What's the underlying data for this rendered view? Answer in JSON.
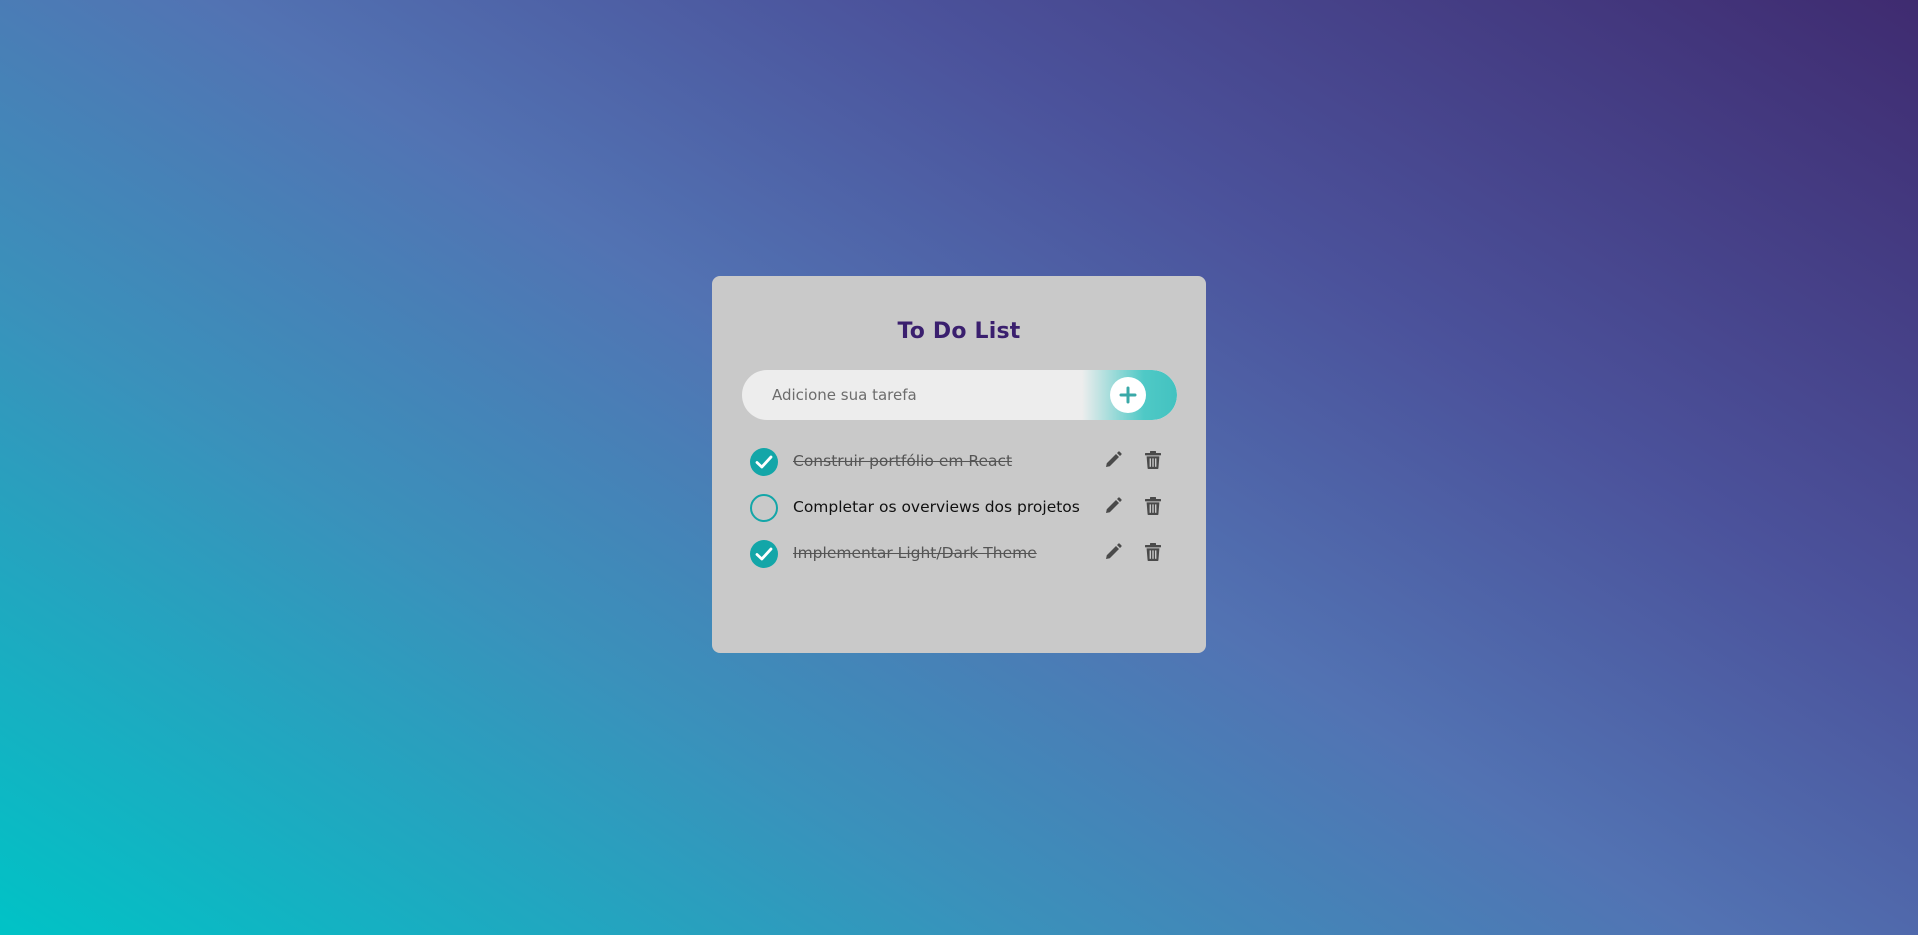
{
  "app": {
    "title": "To Do List"
  },
  "add_task": {
    "placeholder": "Adicione sua tarefa",
    "value": "",
    "button_icon": "plus-icon"
  },
  "tasks": [
    {
      "text": "Construir portfólio em React",
      "completed": true
    },
    {
      "text": "Completar os overviews dos projetos",
      "completed": false
    },
    {
      "text": "Implementar Light/Dark Theme",
      "completed": true
    }
  ],
  "icons": {
    "edit": "pencil-icon",
    "delete": "trash-icon",
    "completed": "check-icon"
  },
  "colors": {
    "title": "#3a1f6e",
    "accent": "#13a6a8",
    "card_background": "#c9c9c9",
    "icon": "#4a4a4a"
  }
}
